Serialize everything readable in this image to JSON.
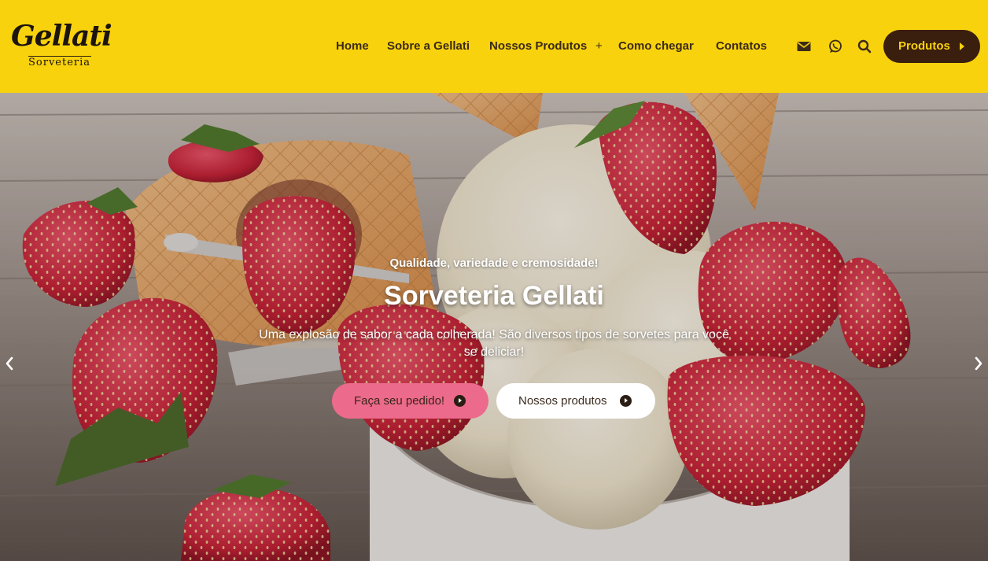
{
  "brand": {
    "logo_word": "Gellati",
    "logo_sub": "Sorveteria",
    "color": "#f8d20c",
    "accent": "#3a1e0e"
  },
  "nav": {
    "items": [
      {
        "label": "Home"
      },
      {
        "label": "Sobre a Gellati"
      },
      {
        "label": "Nossos Produtos",
        "has_submenu": true
      },
      {
        "label": "Como chegar"
      },
      {
        "label": "Contatos"
      }
    ],
    "submenu_indicator": "+"
  },
  "header_icons": [
    "envelope-icon",
    "whatsapp-icon",
    "search-icon"
  ],
  "header_button": {
    "label": "Produtos",
    "icon": "caret-right-icon"
  },
  "hero": {
    "tagline": "Qualidade, variedade e cremosidade!",
    "title": "Sorveteria Gellati",
    "description": "Uma explosão de sabor a cada colherada! São diversos tipos de sorvetes para você se deliciar!",
    "cta_primary": {
      "label": "Faça seu pedido!",
      "color": "#ec6a8c"
    },
    "cta_secondary": {
      "label": "Nossos produtos",
      "color": "#ffffff"
    },
    "arrows": [
      "chevron-left-icon",
      "chevron-right-icon"
    ]
  }
}
